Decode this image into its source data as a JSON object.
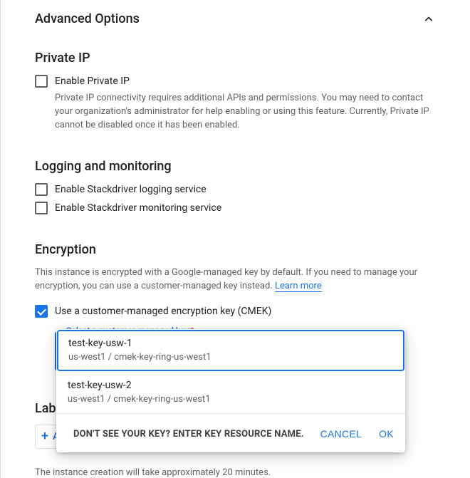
{
  "header": {
    "title": "Advanced Options"
  },
  "private_ip": {
    "title": "Private IP",
    "enable_label": "Enable Private IP",
    "helper": "Private IP connectivity requires additional APIs and permissions. You may need to contact your organization's administrator for help enabling or using this feature. Currently, Private IP cannot be disabled once it has been enabled."
  },
  "logging": {
    "title": "Logging and monitoring",
    "enable_logging_label": "Enable Stackdriver logging service",
    "enable_monitoring_label": "Enable Stackdriver monitoring service"
  },
  "encryption": {
    "title": "Encryption",
    "desc": "This instance is encrypted with a Google-managed key by default. If you need to manage your encryption, you can use a customer-managed key instead.",
    "learn_more": "Learn more",
    "cmek_label": "Use a customer-managed encryption key (CMEK)",
    "select_label": "Select a customer-managed key",
    "required_mark": "*"
  },
  "dropdown": {
    "options": [
      {
        "name": "test-key-usw-1",
        "sub": "us-west1 / cmek-key-ring-us-west1"
      },
      {
        "name": "test-key-usw-2",
        "sub": "us-west1 / cmek-key-ring-us-west1"
      }
    ],
    "prompt": "DON'T SEE YOUR KEY? ENTER KEY RESOURCE NAME.",
    "cancel": "CANCEL",
    "ok": "OK"
  },
  "labels": {
    "title": "Labels",
    "add_label": "ADD LABEL"
  },
  "footer": {
    "note": "The instance creation will take approximately 20 minutes."
  }
}
